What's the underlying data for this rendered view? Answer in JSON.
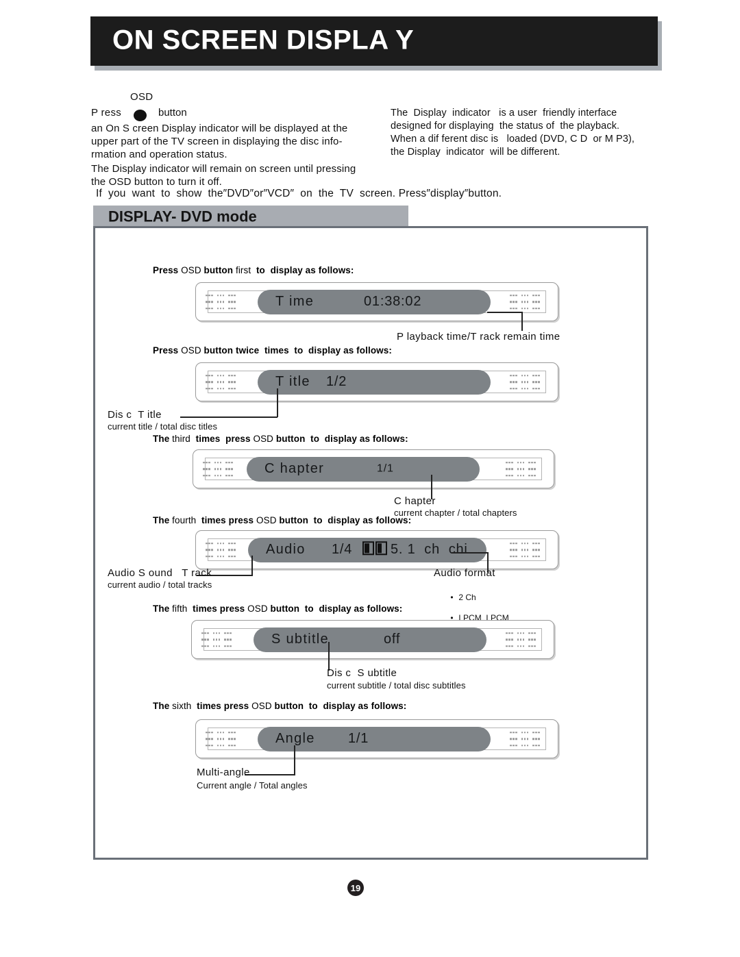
{
  "header": {
    "title": "ON SCREEN DISPLA Y"
  },
  "intro": {
    "osd_label": "OSD",
    "press_word": "P ress",
    "button_word": "button",
    "paragraph1": "an On S creen Display indicator will be displayed at the upper part of the TV screen in displaying the disc  info-rmation and operation status.",
    "paragraph2": "The Display indicator will remain on screen until pressing the OSD  button to turn it off.",
    "right_lines": [
      "The  Display  indicator   is a user  friendly interface",
      "designed for displaying  the status of  the playback.",
      "When a dif ferent disc is   loaded (DVD, C D  or M P3),",
      "the Display  indicator  will be different."
    ],
    "if_line": "If  you  want  to  show  the″DVD″or″VCD″  on  the  TV  screen. Press″display″button."
  },
  "section": {
    "title": "DISPLAY- DVD mode"
  },
  "rows": [
    {
      "instruction_bold_1": "Press ",
      "instruction_reg_1": "OSD ",
      "instruction_bold_2": "button ",
      "instruction_reg_2": "first  ",
      "instruction_bold_3": "to  display as follows:",
      "label": "T ime",
      "value": "01:38:02",
      "callout": "P layback time/T rack remain time",
      "callout_sub": ""
    },
    {
      "instruction_bold_1": "Press ",
      "instruction_reg_1": "OSD ",
      "instruction_bold_2": "button twice  times  to  display as follows:",
      "label": "T itle",
      "value": "1/2",
      "callout": "Dis c  T itle",
      "callout_sub": "current title / total disc titles"
    },
    {
      "instruction_bold_1": "The ",
      "instruction_reg_1": "third  ",
      "instruction_bold_2": "times  press ",
      "instruction_reg_2": "OSD ",
      "instruction_bold_3": "button  to  display as follows:",
      "label": "C hapter",
      "value": "1/1",
      "callout": "C hapter",
      "callout_sub": "current chapter / total chapters"
    },
    {
      "instruction_bold_1": "The ",
      "instruction_reg_1": "fourth  ",
      "instruction_bold_2": "times press ",
      "instruction_reg_2": "OSD ",
      "instruction_bold_3": "button  to  display as follows:",
      "label": "Audio",
      "value_prefix": "1/4",
      "value_suffix": "5. 1  ch  chi",
      "callout": "Audio S ound   T rack",
      "callout_sub": "current audio / total tracks",
      "callout2": "Audio format",
      "callout2_bullets": [
        "2 Ch",
        "LPCM  LPCM"
      ]
    },
    {
      "instruction_bold_1": "The ",
      "instruction_reg_1": "fifth  ",
      "instruction_bold_2": "times press ",
      "instruction_reg_2": "OSD ",
      "instruction_bold_3": "button  to  display as follows:",
      "label": "S ubtitle",
      "value": "off",
      "callout": "Dis c  S ubtitle",
      "callout_sub": "current subtitle / total disc subtitles"
    },
    {
      "instruction_bold_1": "The ",
      "instruction_reg_1": "sixth  ",
      "instruction_bold_2": "times press ",
      "instruction_reg_2": "OSD ",
      "instruction_bold_3": "button  to  display as follows:",
      "label": "Angle",
      "value": "1/1",
      "callout": "Multi-angle",
      "callout_sub": "Current angle / Total angles"
    }
  ],
  "page": {
    "number": "19"
  },
  "colors": {
    "banner_bg": "#1c1c1c",
    "section_bar": "#a8acb2",
    "pill": "#7e8387",
    "frame_border": "#6a7078"
  }
}
